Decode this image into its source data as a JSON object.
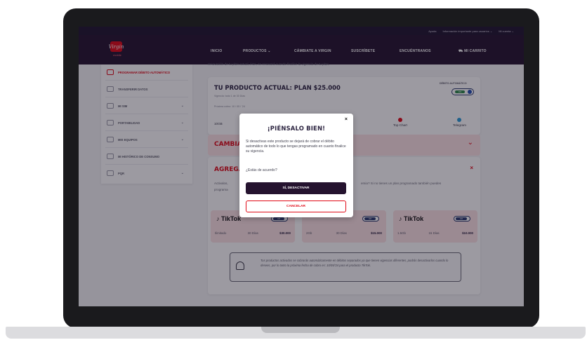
{
  "topbar": {
    "help": "Ayuda",
    "info": "Información importante para usuarios ⌄",
    "account": "Mi cuenta ⌄"
  },
  "nav": {
    "logo": "Virgin",
    "logo_sub": "mobile",
    "items": [
      "INICIO",
      "PRODUCTOS ⌄",
      "CÁMBIATE A VIRGIN",
      "SUSCRÍBETE",
      "ENCUÉNTRANOS"
    ],
    "cart": "MI CARRITO"
  },
  "sidebar": {
    "items": [
      {
        "label": "PROGRAMAR DÉBITO AUTOMÁTICO"
      },
      {
        "label": "TRANSFERIR DATOS"
      },
      {
        "label": "MI SIM"
      },
      {
        "label": "PORTABILIDAD"
      },
      {
        "label": "MIS EQUIPOS"
      },
      {
        "label": "MI HISTÓRICO DE CONSUMO"
      },
      {
        "label": "PQR"
      }
    ]
  },
  "main": {
    "intro": "renovación de tu plan actual, éste, se renovará cuando finalice la vigencia de tu plan.",
    "product": {
      "title": "TU PRODUCTO ACTUAL: PLAN $25.000",
      "subtitle": "Vigencia: todo 1 de 30 Días",
      "renewal": "Próxima cobro: 10 / 05 / '24",
      "auto_label": "DÉBITO AUTOMÁTICO",
      "toggle_on": "ON",
      "data": "10GB",
      "apps": [
        "Top Chart",
        "Telegram"
      ]
    },
    "change_title": "CAMBIA",
    "add": {
      "title": "AGREGA",
      "desc1": "Activalos, ",
      "desc2": "programa",
      "desc3": "emia? Si no tienes un plan programado también puedes",
      "promos": [
        {
          "brand": "TikTok",
          "tag": "Off",
          "a": "Ilimitado",
          "b": "30 Días",
          "price": "$30.000"
        },
        {
          "brand": "",
          "tag": "Off",
          "a": "2Gb",
          "b": "30 Días",
          "price": "$15.000"
        },
        {
          "brand": "TikTok",
          "tag": "Off",
          "a": "1.5Gb",
          "b": "15 Días",
          "price": "$10.000"
        }
      ],
      "notice": "Tus productos activados se cobrarán automáticamente en débitos separados ya que tienen vigencias diferentes, podrás desactivarlos cuando lo desees, por lo tanto la próxima fecha de cobro es: 10/05/'24 para el producto TikTok."
    }
  },
  "modal": {
    "close": "×",
    "title": "¡PIÉNSALO BIEN!",
    "body": "Si desactivas este producto se dejará de cobrar el débito automático de todo lo que tengas programado en cuanto finalice su vigencia.",
    "question": "¿Estás de acuerdo?",
    "confirm": "SÍ, DESACTIVAR",
    "cancel": "CANCELAR"
  }
}
